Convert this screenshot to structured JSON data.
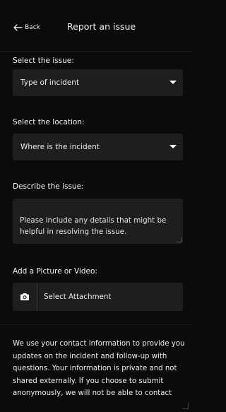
{
  "header": {
    "back_label": "Back",
    "title": "Report an issue"
  },
  "issue": {
    "label": "Select the issue:",
    "value": "Type of incident"
  },
  "location": {
    "label": "Select the location:",
    "value": "Where is the incident"
  },
  "description": {
    "label": "Describe the issue:",
    "placeholder": "Please include any details that might be helpful in resolving the issue."
  },
  "attachment": {
    "label": "Add a Picture or Video:",
    "button_label": "Select Attachment",
    "icon": "camera-icon"
  },
  "disclaimer": "We use your contact information to provide you updates on the incident and follow-up with questions. Your information is private and not shared externally. If you choose to submit anonymously, we will not be able to contact",
  "colors": {
    "background": "#0b0b0b",
    "field": "#1e1e1e",
    "text": "#f2f2f2"
  }
}
